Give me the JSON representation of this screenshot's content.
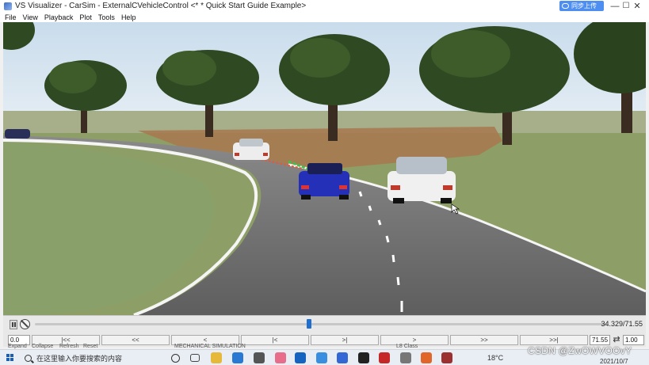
{
  "window": {
    "title": "VS Visualizer - CarSim - ExternalCVehicleControl <* * Quick Start Guide Example>",
    "cloud_button_label": "同步上传",
    "minimize_glyph": "—",
    "maximize_glyph": "☐",
    "close_glyph": "✕"
  },
  "menu": {
    "items": [
      "File",
      "View",
      "Playback",
      "Plot",
      "Tools",
      "Help"
    ]
  },
  "playback": {
    "time_readout": "34.329/71.55",
    "current_time": 34.329,
    "end_time": 71.55,
    "start_value": "0.0",
    "end_value": "71.55",
    "speed_value": "1.00",
    "buttons": [
      "|<<",
      "<<",
      "<",
      "|<",
      ">|",
      ">",
      ">>",
      ">>|"
    ],
    "loop_glyph": "⇄"
  },
  "panels": {
    "peek_labels": [
      "Expand",
      "Collapse",
      "Refresh",
      "Reset",
      "MECHANICAL SIMULATION",
      "L8 Class"
    ]
  },
  "taskbar": {
    "search_placeholder": "在这里输入你要搜索的内容",
    "temperature": "18°C",
    "date": "2021/10/7",
    "apps": [
      "cortana-icon",
      "task-view-icon",
      "file-explorer-icon",
      "vscode-icon",
      "app-icon",
      "app-icon",
      "outlook-icon",
      "app-icon",
      "todo-icon",
      "typora-icon",
      "app-icon",
      "app-icon",
      "matlab-icon",
      "carsim-icon"
    ]
  },
  "watermark": "CSDN @ZwOWVOOvY",
  "colors": {
    "sky": "#dbe7f1",
    "grass": "#8ea066",
    "road": "#6c6c6c",
    "dirt": "#a8784f",
    "ego_car": "#2430b8",
    "accent": "#1f6fd1"
  }
}
